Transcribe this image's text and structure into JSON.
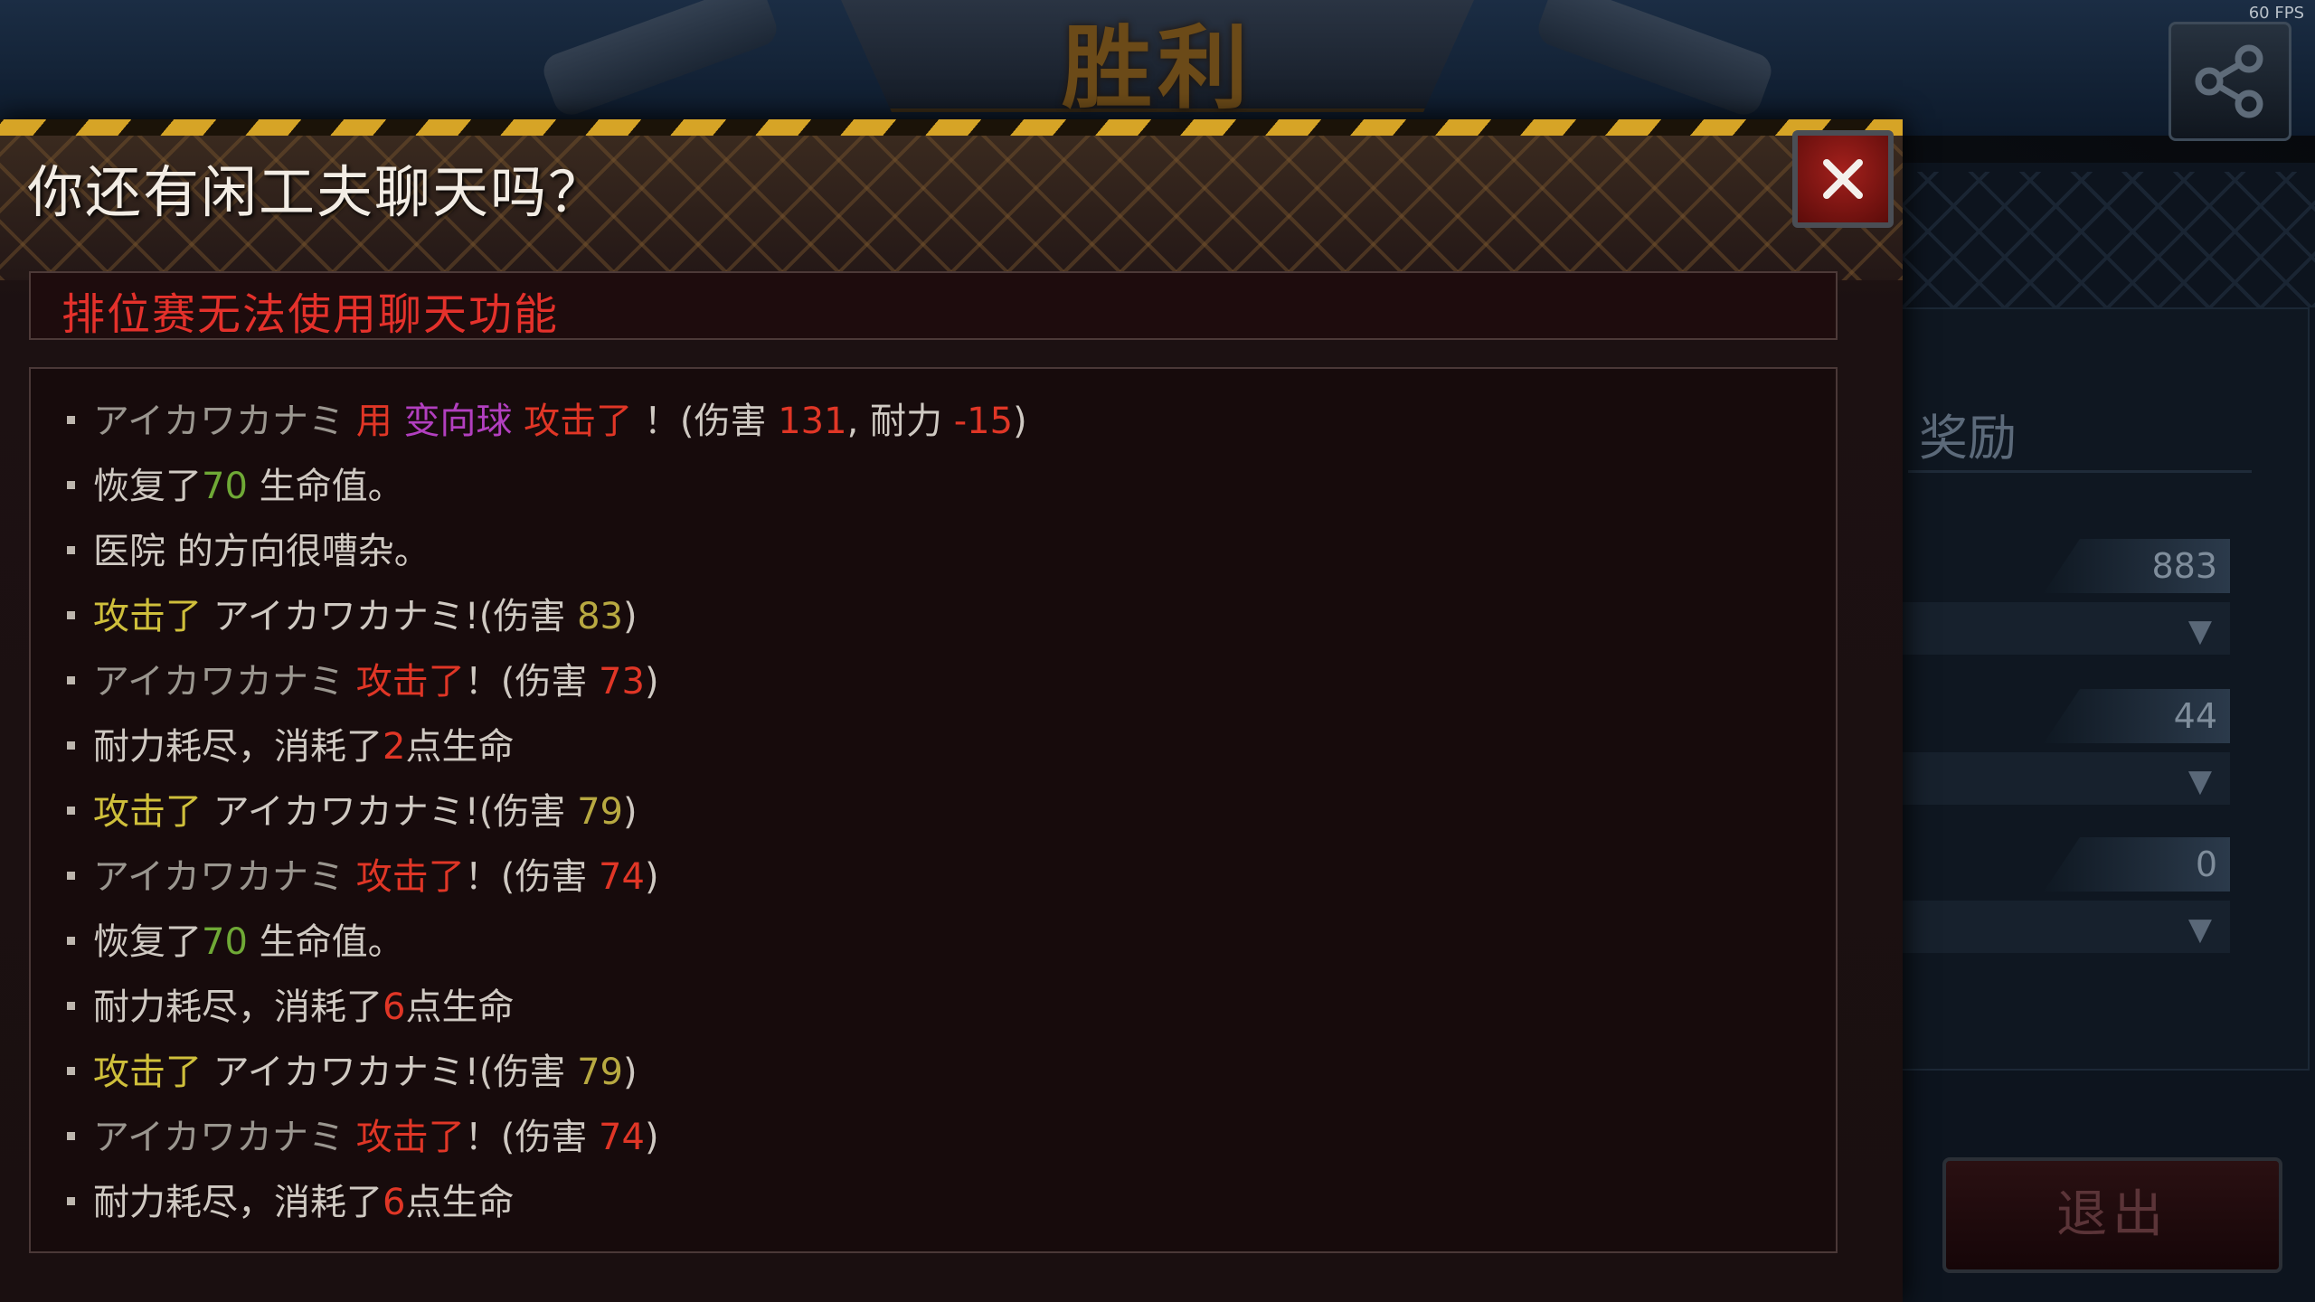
{
  "header": {
    "victory_title": "胜利",
    "fps": "60 FPS"
  },
  "right_panel": {
    "reward_title": "奖励",
    "values": [
      "883",
      "44",
      "0"
    ],
    "exit_label": "退出"
  },
  "modal": {
    "title": "你还有闲工夫聊天吗？",
    "notice": "排位赛无法使用聊天功能"
  },
  "log": [
    [
      "アイカワカナミ",
      "  ",
      "用 ",
      "变向球",
      " 攻击了",
      " ！(伤害 ",
      "131",
      ",  耐力  ",
      "-15",
      ")"
    ],
    [
      "恢复了",
      "70",
      " 生命值。"
    ],
    [
      "医院 的方向很嘈杂。"
    ],
    [
      "攻击了",
      " アイカワカナミ!(伤害 ",
      "83",
      ")"
    ],
    [
      "アイカワカナミ",
      "  ",
      "攻击了",
      "！(伤害 ",
      "73",
      ")"
    ],
    [
      "耐力耗尽，消耗了",
      "2",
      "点生命"
    ],
    [
      "攻击了",
      " アイカワカナミ!(伤害 ",
      "79",
      ")"
    ],
    [
      "アイカワカナミ",
      "  ",
      "攻击了",
      "！(伤害 ",
      "74",
      ")"
    ],
    [
      "恢复了",
      "70",
      " 生命值。"
    ],
    [
      "耐力耗尽，消耗了",
      "6",
      "点生命"
    ],
    [
      "攻击了",
      " アイカワカナミ!(伤害 ",
      "79",
      ")"
    ],
    [
      "アイカワカナミ",
      "  ",
      "攻击了",
      "！(伤害 ",
      "74",
      ")"
    ],
    [
      "耐力耗尽，消耗了",
      "6",
      "点生命"
    ]
  ]
}
